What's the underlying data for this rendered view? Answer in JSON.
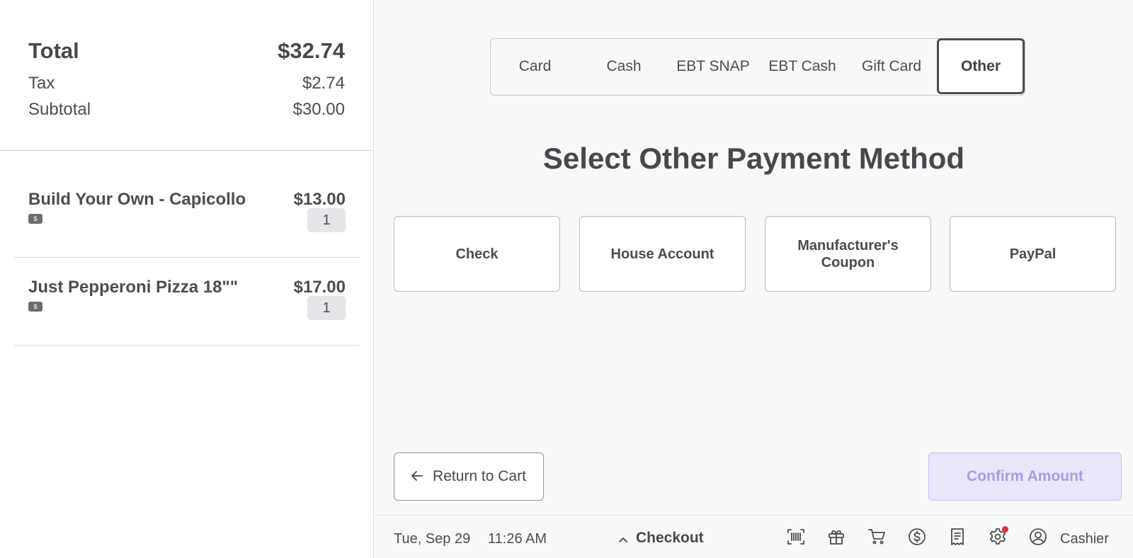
{
  "summary": {
    "total_label": "Total",
    "total_value": "$32.74",
    "tax_label": "Tax",
    "tax_value": "$2.74",
    "subtotal_label": "Subtotal",
    "subtotal_value": "$30.00"
  },
  "cart": {
    "items": [
      {
        "name": "Build Your Own - Capicollo",
        "price": "$13.00",
        "tag": "$",
        "qty": "1"
      },
      {
        "name": "Just Pepperoni Pizza 18\"\"",
        "price": "$17.00",
        "tag": "$",
        "qty": "1"
      }
    ]
  },
  "tabs": [
    {
      "label": "Card"
    },
    {
      "label": "Cash"
    },
    {
      "label": "EBT SNAP"
    },
    {
      "label": "EBT Cash"
    },
    {
      "label": "Gift Card"
    },
    {
      "label": "Other",
      "active": true
    }
  ],
  "heading": "Select Other Payment Method",
  "methods": [
    {
      "label": "Check"
    },
    {
      "label": "House Account"
    },
    {
      "label": "Manufacturer's Coupon"
    },
    {
      "label": "PayPal"
    }
  ],
  "actions": {
    "return_label": "Return to Cart",
    "confirm_label": "Confirm Amount"
  },
  "footer": {
    "date": "Tue, Sep 29",
    "time": "11:26 AM",
    "checkout_label": "Checkout",
    "user_label": "Cashier",
    "icons": [
      "barcode-scan-icon",
      "gift-icon",
      "cart-icon",
      "dollar-icon",
      "receipt-icon",
      "settings-icon",
      "user-icon"
    ]
  },
  "colors": {
    "confirm_bg": "#ebe6fa",
    "confirm_text": "#a99ce3",
    "notification_dot": "#d9323a"
  }
}
